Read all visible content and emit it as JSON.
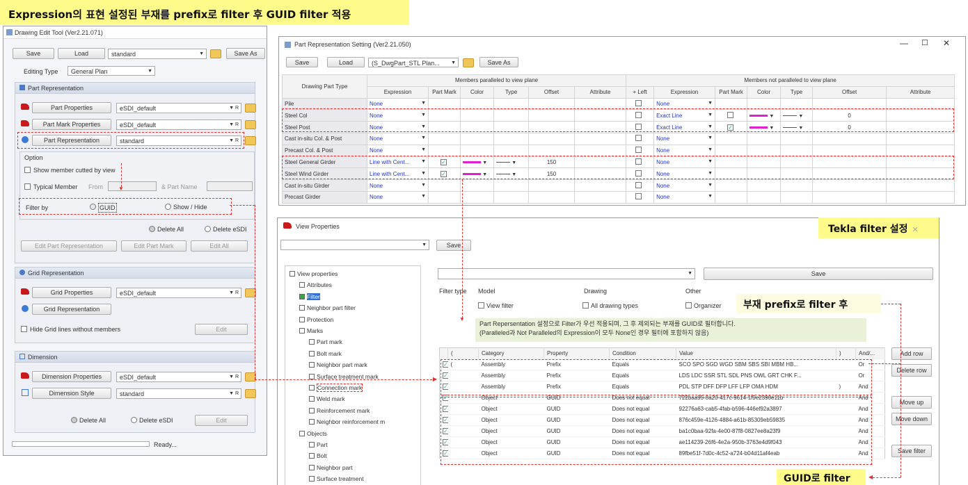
{
  "banners": {
    "top": "Expression의 표현 설정된 부재를 prefix로 filter 후 GUID filter 적용",
    "tekla": "Tekla filter 설정",
    "prefix": "부재 prefix로 filter 후",
    "guid": "GUID로 filter"
  },
  "dwg": {
    "title": "Drawing Edit Tool (Ver2.21.071)",
    "save": "Save",
    "load": "Load",
    "preset": "standard",
    "save_as": "Save As",
    "editing_type_label": "Editing Type",
    "editing_type": "General Plan",
    "part_rep_header": "Part Representation",
    "part_props_btn": "Part Properties",
    "part_props_val": "eSDI_default",
    "part_mark_btn": "Part Mark Properties",
    "part_mark_val": "eSDI_default",
    "part_rep_btn": "Part Representation",
    "part_rep_val": "standard",
    "r": "R",
    "option": "Option",
    "show_cut": "Show member cutted by view",
    "typical": "Typical Member",
    "from": "From",
    "part_name": "& Part Name",
    "filter_by": "Filter by",
    "guid": "GUID",
    "show_hide": "Show / Hide",
    "delete_all": "Delete All",
    "delete_esdi": "Delete eSDI",
    "edit_part_rep": "Edit Part Representation",
    "edit_part_mark": "Edit Part Mark",
    "edit_all": "Edit All",
    "grid_header": "Grid Representation",
    "grid_props_btn": "Grid Properties",
    "grid_props_val": "eSDI_default",
    "grid_rep_btn": "Grid Representation",
    "hide_grid": "Hide Grid lines without members",
    "edit": "Edit",
    "dim_header": "Dimension",
    "dim_props_btn": "Dimension Properties",
    "dim_props_val": "eSDI_default",
    "dim_style_btn": "Dimension Style",
    "dim_style_val": "standard",
    "ready": "Ready..."
  },
  "prs": {
    "title": "Part Representation Setting (Ver2.21.050)",
    "save": "Save",
    "load": "Load",
    "preset": "(S_DwgPart_STL Plan...",
    "save_as": "Save As",
    "grp_parallel": "Members paralleled to view plane",
    "grp_not": "Members not paralleled to view plane",
    "dpt": "Drawing Part Type",
    "cols": [
      "Expression",
      "Part Mark",
      "Color",
      "Type",
      "Offset",
      "Attribute",
      "+ Left",
      "Expression",
      "Part Mark",
      "Color",
      "Type",
      "Offset",
      "Attribute"
    ],
    "rows": [
      {
        "name": "Pile",
        "e1": "None",
        "pm": "",
        "col": false,
        "typ": false,
        "off": "",
        "e2": "None",
        "pm2": "",
        "col2": false,
        "off2": ""
      },
      {
        "name": "Steel Col",
        "e1": "None",
        "pm": "",
        "col": false,
        "typ": false,
        "off": "",
        "e2": "Exact Line",
        "pm2": "box",
        "col2": true,
        "off2": "0"
      },
      {
        "name": "Steel Post",
        "e1": "None",
        "pm": "",
        "col": false,
        "typ": false,
        "off": "",
        "e2": "Exact Line",
        "pm2": "check",
        "col2": true,
        "off2": "0"
      },
      {
        "name": "Cast in-situ Col. & Post",
        "e1": "None",
        "pm": "",
        "col": false,
        "typ": false,
        "off": "",
        "e2": "None",
        "pm2": "",
        "col2": false,
        "off2": ""
      },
      {
        "name": "Precast Col. & Post",
        "e1": "None",
        "pm": "",
        "col": false,
        "typ": false,
        "off": "",
        "e2": "None",
        "pm2": "",
        "col2": false,
        "off2": ""
      },
      {
        "name": "Steel General Girder",
        "e1": "Line with Cent...",
        "pm": "check",
        "col": true,
        "typ": true,
        "off": "150",
        "e2": "None",
        "pm2": "",
        "col2": false,
        "off2": ""
      },
      {
        "name": "Steel Wind Girder",
        "e1": "Line with Cent...",
        "pm": "check",
        "col": true,
        "typ": true,
        "off": "150",
        "e2": "None",
        "pm2": "",
        "col2": false,
        "off2": ""
      },
      {
        "name": "Cast in-situ Girder",
        "e1": "None",
        "pm": "",
        "col": false,
        "typ": false,
        "off": "",
        "e2": "None",
        "pm2": "",
        "col2": false,
        "off2": ""
      },
      {
        "name": "Precast Girder",
        "e1": "None",
        "pm": "",
        "col": false,
        "typ": false,
        "off": "",
        "e2": "None",
        "pm2": "",
        "col2": false,
        "off2": ""
      }
    ]
  },
  "vp": {
    "title": "View Properties",
    "save": "Save",
    "tree": [
      [
        "View properties",
        0
      ],
      [
        "Attributes",
        1
      ],
      [
        "Filter",
        1
      ],
      [
        "Neighbor part filter",
        1
      ],
      [
        "Protection",
        1
      ],
      [
        "Marks",
        1
      ],
      [
        "Part mark",
        2
      ],
      [
        "Bolt mark",
        2
      ],
      [
        "Neighbor part mark",
        2
      ],
      [
        "Surface treatment mark",
        2
      ],
      [
        "Connection mark",
        2
      ],
      [
        "Weld mark",
        2
      ],
      [
        "Reinforcement mark",
        2
      ],
      [
        "Neighbor reinforcement m",
        2
      ],
      [
        "Objects",
        1
      ],
      [
        "Part",
        2
      ],
      [
        "Bolt",
        2
      ],
      [
        "Neighbor part",
        2
      ],
      [
        "Surface treatment",
        2
      ]
    ],
    "filter_type": "Filter type",
    "model": "Model",
    "drawing": "Drawing",
    "other": "Other",
    "view_filter": "View filter",
    "all_drawing_types": "All drawing types",
    "organizer": "Organizer",
    "note1": "Part Repersentation 설정으로 Filter가 우선 적용되며, 그 후 제외되는 부재를 GUID로 필터합니다.",
    "note2": "(Paralleled과 Not Paralleled의 Expression이 모두 None인 경우 필터에 포함하지 않음)",
    "headers": [
      "(",
      "Category",
      "Property",
      "Condition",
      "Value",
      ")",
      "And/..."
    ],
    "rows": [
      [
        "(",
        "Assembly",
        "Prefix",
        "Equals",
        "SCO SPO SGD WGD SBM SBS SBI MBM HB...",
        "",
        "Or"
      ],
      [
        "",
        "Assembly",
        "Prefix",
        "Equals",
        "LDS LDC SSR STL SDL PNS OWL GRT CHK F...",
        "",
        "Or"
      ],
      [
        "",
        "Assembly",
        "Prefix",
        "Equals",
        "PDL STP DFF DFP LFF LFP OMA HDM",
        ")",
        "And"
      ],
      [
        "",
        "Object",
        "GUID",
        "Does not equal",
        "722baa95-0a20-417c-9614-1f9e2390e11b",
        "",
        "And"
      ],
      [
        "",
        "Object",
        "GUID",
        "Does not equal",
        "92276a63-cab5-4fab-b596-446ef92a3897",
        "",
        "And"
      ],
      [
        "",
        "Object",
        "GUID",
        "Does not equal",
        "876c459e-4126-4884-a61b-85309eb59835",
        "",
        "And"
      ],
      [
        "",
        "Object",
        "GUID",
        "Does not equal",
        "ba1c0baa-92fa-4e00-87f8-0827ee8a23f9",
        "",
        "And"
      ],
      [
        "",
        "Object",
        "GUID",
        "Does not equal",
        "ae114239-26f6-4e2a-950b-3763e4d9f043",
        "",
        "And"
      ],
      [
        "",
        "Object",
        "GUID",
        "Does not equal",
        "89fbe51f-7d0c-4c52-a724-b04d11af4eab",
        "",
        "And"
      ]
    ],
    "add_row": "Add row",
    "delete_row": "Delete row",
    "move_up": "Move up",
    "move_down": "Move down",
    "save_filter": "Save filter"
  }
}
